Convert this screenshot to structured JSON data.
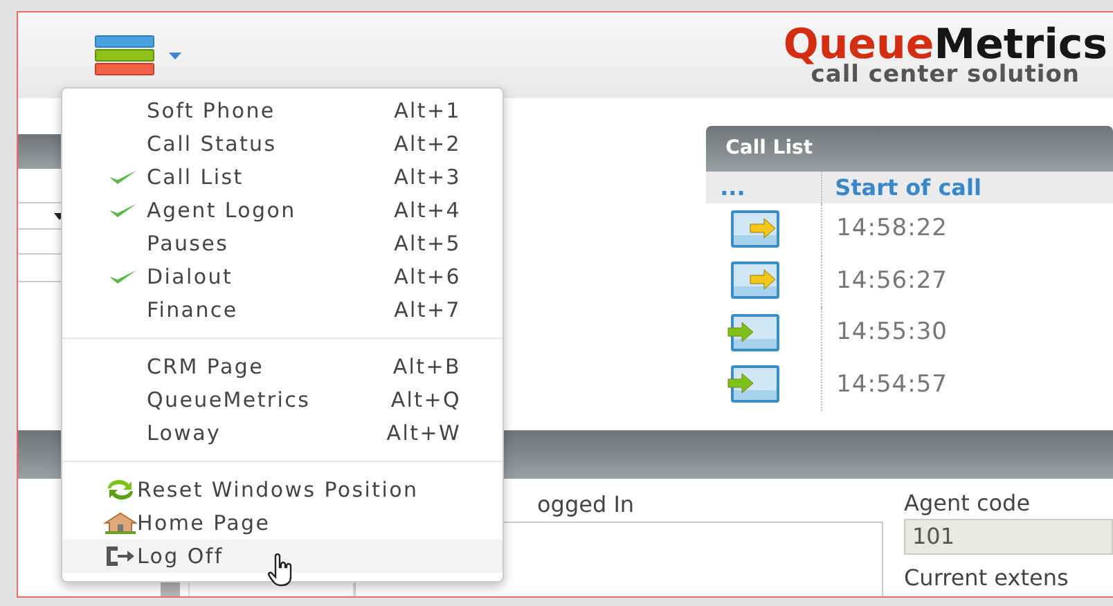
{
  "header": {
    "logo": {
      "words": [
        "Queue",
        "Metrics"
      ],
      "tagline": "call center solution"
    }
  },
  "menu": {
    "sections": [
      {
        "kind": "shortcuts",
        "items": [
          {
            "label": "Soft Phone",
            "shortcut": "Alt+1",
            "checked": false
          },
          {
            "label": "Call Status",
            "shortcut": "Alt+2",
            "checked": false
          },
          {
            "label": "Call List",
            "shortcut": "Alt+3",
            "checked": true
          },
          {
            "label": "Agent Logon",
            "shortcut": "Alt+4",
            "checked": true
          },
          {
            "label": "Pauses",
            "shortcut": "Alt+5",
            "checked": false
          },
          {
            "label": "Dialout",
            "shortcut": "Alt+6",
            "checked": true
          },
          {
            "label": "Finance",
            "shortcut": "Alt+7",
            "checked": false
          }
        ]
      },
      {
        "kind": "shortcuts",
        "items": [
          {
            "label": "CRM Page",
            "shortcut": "Alt+B",
            "checked": false
          },
          {
            "label": "QueueMetrics",
            "shortcut": "Alt+Q",
            "checked": false
          },
          {
            "label": "Loway",
            "shortcut": "Alt+W",
            "checked": false
          }
        ]
      },
      {
        "kind": "links",
        "items": [
          {
            "kind": "refresh",
            "label": "Reset Windows Position",
            "hovered": false
          },
          {
            "kind": "home",
            "label": "Home Page",
            "hovered": false
          },
          {
            "kind": "logout",
            "label": "Log Off",
            "hovered": true
          }
        ]
      }
    ]
  },
  "call_list": {
    "title": "Call List",
    "columns": [
      "...",
      "Start of call"
    ],
    "rows": [
      {
        "color": "#f5c518",
        "time": "14:58:22"
      },
      {
        "color": "#f5c518",
        "time": "14:56:27"
      },
      {
        "color": "#7cc21a",
        "time": "14:55:30"
      },
      {
        "color": "#7cc21a",
        "time": "14:54:57"
      }
    ]
  },
  "agent_panel": {
    "logged_in_label": "ogged In",
    "agent_code_label": "Agent code",
    "agent_code": "101",
    "extension_label": "Current extens"
  }
}
